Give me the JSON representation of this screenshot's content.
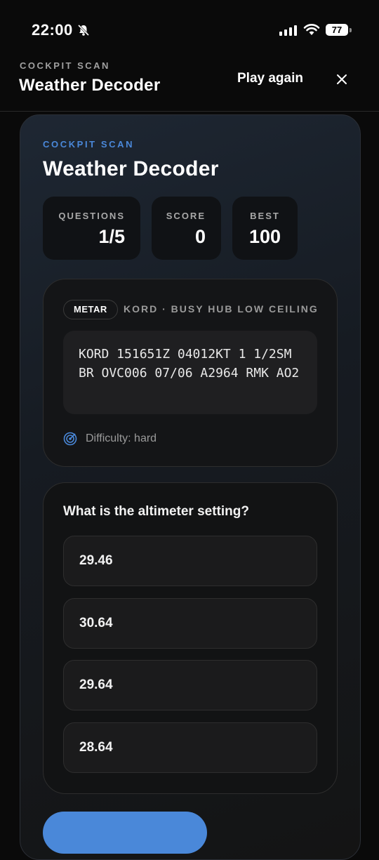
{
  "status_bar": {
    "time": "22:00",
    "battery": "77"
  },
  "header": {
    "eyebrow": "COCKPIT SCAN",
    "title": "Weather Decoder",
    "play_again": "Play again"
  },
  "card": {
    "eyebrow": "COCKPIT SCAN",
    "title": "Weather Decoder",
    "stats": [
      {
        "label": "QUESTIONS",
        "value": "1/5"
      },
      {
        "label": "SCORE",
        "value": "0"
      },
      {
        "label": "BEST",
        "value": "100"
      }
    ]
  },
  "metar": {
    "type": "METAR",
    "station": "KORD · BUSY HUB LOW CEILING",
    "raw": "KORD 151651Z 04012KT 1 1/2SM BR OVC006 07/06 A2964 RMK AO2",
    "difficulty": "Difficulty: hard"
  },
  "question": {
    "text": "What is the altimeter setting?",
    "options": [
      "29.46",
      "30.64",
      "29.64",
      "28.64"
    ]
  },
  "colors": {
    "accent": "#4a88d9",
    "background": "#0a0a0a"
  }
}
